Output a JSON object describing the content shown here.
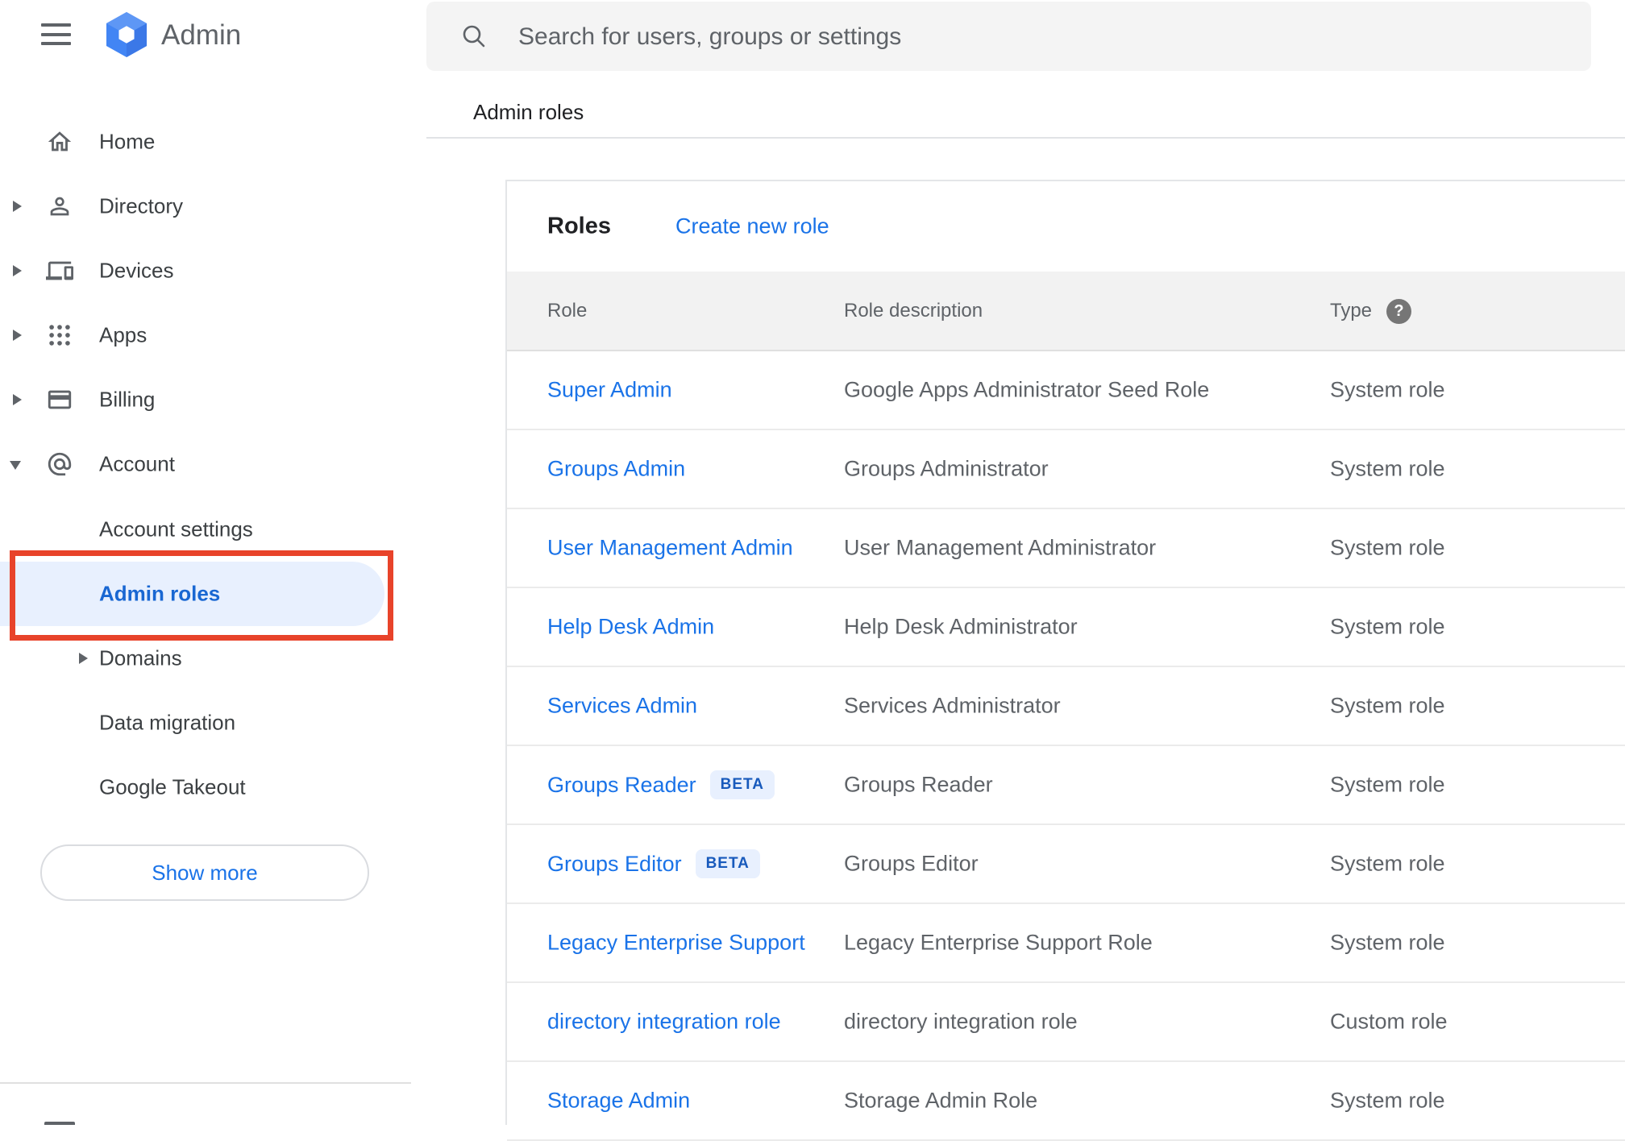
{
  "topbar": {
    "product_name": "Admin",
    "search_placeholder": "Search for users, groups or settings"
  },
  "breadcrumb": "Admin roles",
  "sidebar": {
    "items": [
      {
        "label": "Home",
        "icon": "home",
        "caret": "none"
      },
      {
        "label": "Directory",
        "icon": "person",
        "caret": "right"
      },
      {
        "label": "Devices",
        "icon": "devices",
        "caret": "right"
      },
      {
        "label": "Apps",
        "icon": "apps-grid",
        "caret": "right"
      },
      {
        "label": "Billing",
        "icon": "credit-card",
        "caret": "right"
      },
      {
        "label": "Account",
        "icon": "at-sign",
        "caret": "down"
      }
    ],
    "account_children": [
      {
        "label": "Account settings",
        "caret": "none",
        "selected": false
      },
      {
        "label": "Admin roles",
        "caret": "none",
        "selected": true
      },
      {
        "label": "Domains",
        "caret": "right",
        "selected": false
      },
      {
        "label": "Data migration",
        "caret": "none",
        "selected": false
      },
      {
        "label": "Google Takeout",
        "caret": "none",
        "selected": false
      }
    ],
    "show_more_label": "Show more"
  },
  "main": {
    "title": "Roles",
    "create_link": "Create new role",
    "table": {
      "columns": [
        "Role",
        "Role description",
        "Type"
      ],
      "help_glyph": "?",
      "rows": [
        {
          "role": "Super Admin",
          "beta_label": "",
          "description": "Google Apps Administrator Seed Role",
          "type": "System role"
        },
        {
          "role": "Groups Admin",
          "beta_label": "",
          "description": "Groups Administrator",
          "type": "System role"
        },
        {
          "role": "User Management Admin",
          "beta_label": "",
          "description": "User Management Administrator",
          "type": "System role"
        },
        {
          "role": "Help Desk Admin",
          "beta_label": "",
          "description": "Help Desk Administrator",
          "type": "System role"
        },
        {
          "role": "Services Admin",
          "beta_label": "",
          "description": "Services Administrator",
          "type": "System role"
        },
        {
          "role": "Groups Reader",
          "beta_label": "BETA",
          "description": "Groups Reader",
          "type": "System role"
        },
        {
          "role": "Groups Editor",
          "beta_label": "BETA",
          "description": "Groups Editor",
          "type": "System role"
        },
        {
          "role": "Legacy Enterprise Support",
          "beta_label": "",
          "description": "Legacy Enterprise Support Role",
          "type": "System role"
        },
        {
          "role": "directory integration role",
          "beta_label": "",
          "description": "directory integration role",
          "type": "Custom role"
        },
        {
          "role": "Storage Admin",
          "beta_label": "",
          "description": "Storage Admin Role",
          "type": "System role"
        }
      ]
    }
  },
  "colors": {
    "accent_blue": "#1a73e8",
    "selected_blue": "#1967d2",
    "selected_bg": "#e8f0fe",
    "beta_text": "#185abc",
    "beta_bg": "#e8f0fe",
    "annotation_red": "#e8432a",
    "logo_blue": "#4285f4",
    "text_dark": "#202124",
    "text_gray": "#5f6368",
    "search_bg": "#f4f4f4",
    "table_header_bg": "#f2f2f2",
    "border_gray": "#e0e0e0"
  }
}
